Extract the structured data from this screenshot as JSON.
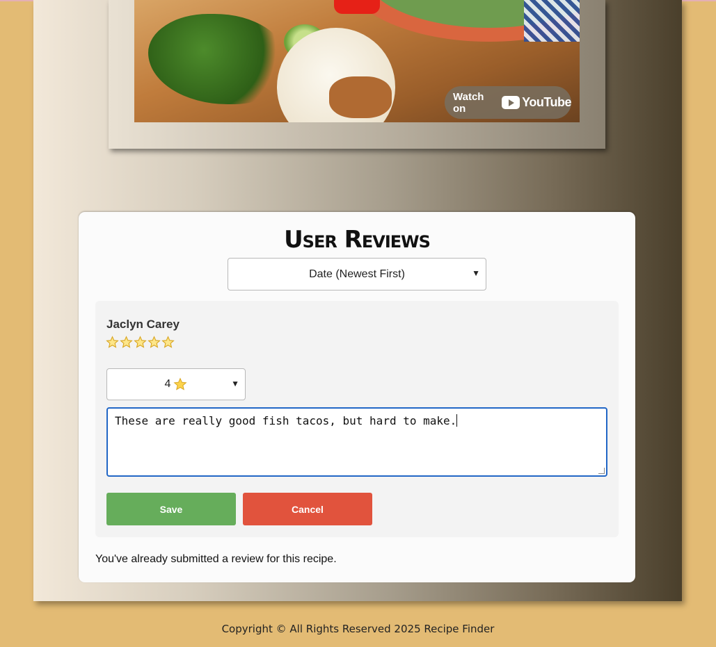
{
  "video": {
    "watch_label": "Watch on",
    "brand": "YouTube"
  },
  "reviews": {
    "title": "User Reviews",
    "sort_selected": "Date (Newest First)",
    "items": [
      {
        "reviewer": "Jaclyn Carey",
        "rating_select": "4",
        "text": "These are really good fish tacos, but hard to make."
      }
    ],
    "save_label": "Save",
    "cancel_label": "Cancel",
    "already_submitted": "You've already submitted a review for this recipe."
  },
  "footer": {
    "copyright": "Copyright © All Rights Reserved 2025 Recipe Finder"
  }
}
